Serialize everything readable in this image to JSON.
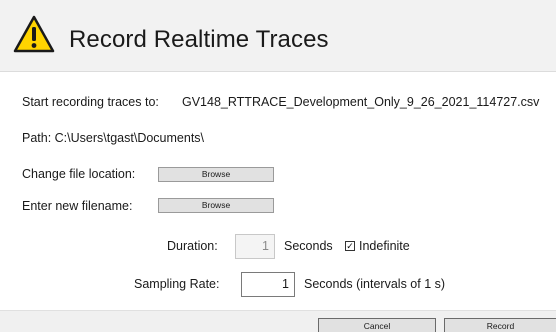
{
  "dialog": {
    "title": "Record Realtime Traces",
    "icon": "warning-icon"
  },
  "recording": {
    "prefix": "Start recording traces to:",
    "filename": "GV148_RTTRACE_Development_Only_9_26_2021_114727.csv",
    "path_text": "Path: C:\\Users\\tgast\\Documents\\"
  },
  "file_options": {
    "change_location_label": "Change file location:",
    "change_location_button": "Browse",
    "new_filename_label": "Enter new filename:",
    "new_filename_button": "Browse"
  },
  "duration": {
    "label": "Duration:",
    "value": "1",
    "unit": "Seconds",
    "indefinite_label": "Indefinite",
    "indefinite_checked": true
  },
  "sampling": {
    "label": "Sampling Rate:",
    "value": "1",
    "unit": "Seconds (intervals of 1 s)"
  },
  "footer": {
    "cancel_label": "Cancel",
    "record_label": "Record"
  },
  "colors": {
    "header_bg": "#f2f2f2",
    "warning_fill": "#ffd400"
  }
}
